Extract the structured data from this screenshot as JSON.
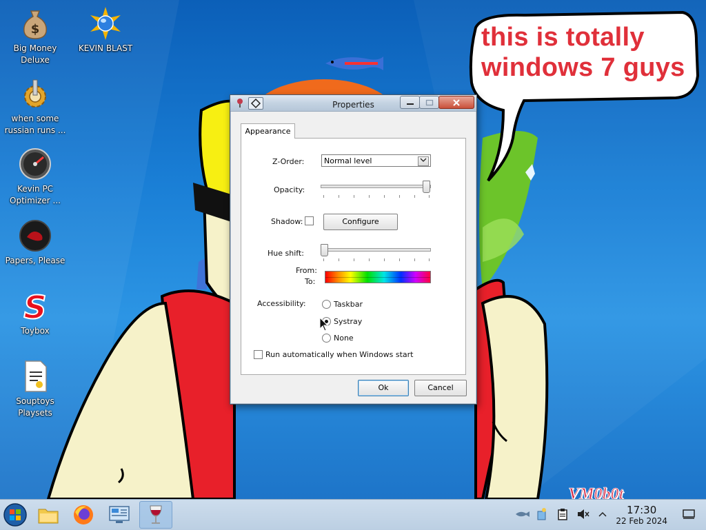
{
  "desktop": {
    "icons": [
      {
        "label": "Big Money\nDeluxe",
        "icon": "money-bag-icon"
      },
      {
        "label": "KEVIN BLAST",
        "icon": "kevin-blast-icon"
      },
      {
        "label": "when some\nrussian runs ...",
        "icon": "gear-icon"
      },
      {
        "label": "Kevin PC\nOptimizer ...",
        "icon": "gauge-icon"
      },
      {
        "label": "Papers, Please",
        "icon": "papers-please-icon"
      },
      {
        "label": "Toybox",
        "icon": "toybox-icon"
      },
      {
        "label": "Souptoys\nPlaysets",
        "icon": "document-icon"
      }
    ],
    "bubble_text": "this is totally windows 7 guys",
    "watermark": "VM0b0t"
  },
  "window": {
    "title": "Properties",
    "tab": "Appearance",
    "zorder_label": "Z-Order:",
    "zorder_value": "Normal level",
    "opacity_label": "Opacity:",
    "opacity_value": 1.0,
    "shadow_label": "Shadow:",
    "shadow_checked": false,
    "configure_label": "Configure",
    "hue_label": "Hue shift:",
    "hue_value": 0.0,
    "from_label": "From:",
    "to_label": "To:",
    "accessibility_label": "Accessibility:",
    "radio_options": [
      {
        "label": "Taskbar",
        "selected": false
      },
      {
        "label": "Systray",
        "selected": true
      },
      {
        "label": "None",
        "selected": false
      }
    ],
    "autorun_label": "Run automatically when Windows start",
    "autorun_checked": false,
    "ok_label": "Ok",
    "cancel_label": "Cancel"
  },
  "taskbar": {
    "time": "17:30",
    "date": "22 Feb 2024",
    "pinned": [
      "start-orb-icon",
      "file-explorer-icon",
      "firefox-icon",
      "control-panel-icon",
      "wine-glass-icon"
    ],
    "active_item": "wine-glass-icon",
    "tray": [
      "fish-tray-icon",
      "paint-bucket-tray-icon",
      "clipboard-tray-icon",
      "speaker-muted-icon",
      "chevron-up-icon"
    ]
  },
  "colors": {
    "bubble_text": "#e0303a",
    "desktop_bg": "#1a7fd6",
    "taskbar_bg": "#cfdceb",
    "close_button": "#c9503a"
  }
}
